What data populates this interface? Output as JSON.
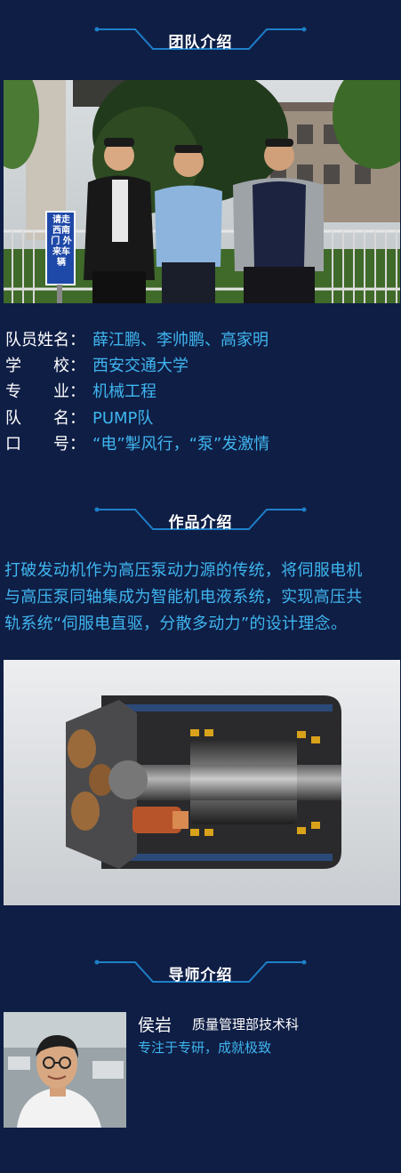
{
  "sections": {
    "team": {
      "title": "团队介绍"
    },
    "work": {
      "title": "作品介绍"
    },
    "mentor": {
      "title": "导师介绍"
    }
  },
  "team_info": [
    {
      "label": "队员姓名：",
      "value": "薛江鹏、李帅鹏、高家明"
    },
    {
      "label": "学　　校：",
      "value": "西安交通大学"
    },
    {
      "label": "专　　业：",
      "value": "机械工程"
    },
    {
      "label": "队　　名：",
      "value": "PUMP队"
    },
    {
      "label": "口　　号：",
      "value": "“电”掣风行，“泵”发激情"
    }
  ],
  "team_photo": {
    "sign_text": "请走西南门 外来车辆"
  },
  "work_description": [
    "打破发动机作为高压泵动力源的传统，将伺服电机",
    "与高压泵同轴集成为智能机电液系统，实现高压共",
    "轨系统“伺服电直驱，分散多动力”的设计理念。"
  ],
  "mentor": {
    "name": "侯岩",
    "department": "质量管理部技术科",
    "motto": "专注于专研，成就极致"
  },
  "colors": {
    "background": "#0f1e45",
    "accent": "#3fb6f0",
    "header_line": "#1e7fc8"
  }
}
